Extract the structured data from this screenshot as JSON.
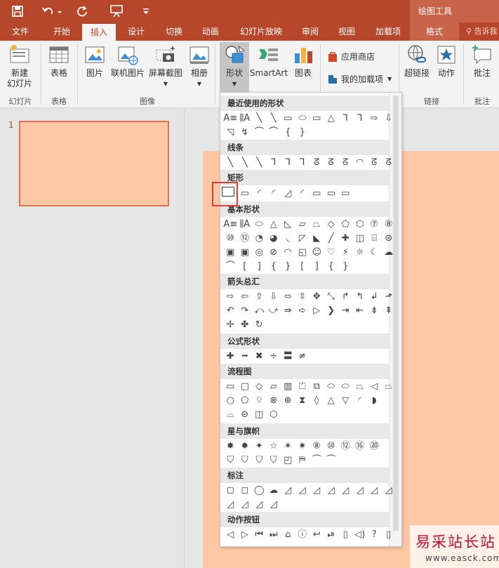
{
  "quick_access": {
    "save_icon": "save-icon",
    "undo_icon": "undo-icon",
    "redo_icon": "repeat-icon",
    "present_icon": "present-from-start-icon",
    "customize_icon": "customize-qat-icon"
  },
  "contextual_group": "绘图工具",
  "tabs": [
    "文件",
    "开始",
    "插入",
    "设计",
    "切换",
    "动画",
    "幻灯片放映",
    "审阅",
    "视图",
    "加载项",
    "格式"
  ],
  "active_tab": "插入",
  "tell_me": "告诉我",
  "ribbon": {
    "new_slide": [
      "新建",
      "幻灯片"
    ],
    "table": "表格",
    "picture": "图片",
    "online_picture": "联机图片",
    "screenshot": "屏幕截图",
    "album": "相册",
    "shapes": "形状",
    "smartart": "SmartArt",
    "chart": "图表",
    "store": "应用商店",
    "my_addins": "我的加载项",
    "hyperlink": "超链接",
    "action": "动作",
    "comment": "批注",
    "groups": {
      "slides": "幻灯片",
      "tables": "表格",
      "images": "图像",
      "links": "链接",
      "comments": "批注"
    }
  },
  "slide_panel": {
    "slide_number": "1"
  },
  "gallery": {
    "categories": [
      "最近使用的形状",
      "线条",
      "矩形",
      "基本形状",
      "箭头总汇",
      "公式形状",
      "流程图",
      "星与旗帜",
      "标注",
      "动作按钮"
    ],
    "rows": {
      "recent": [
        [
          "A≡",
          "⫼A",
          "╲",
          "╲",
          "▭",
          "⬭",
          "▭",
          "△",
          "⅂",
          "⅂",
          "⇨",
          "⇩"
        ],
        [
          "◹",
          "↯",
          "⌒",
          "⌒",
          "{",
          "}"
        ]
      ],
      "lines": [
        [
          "╲",
          "╲",
          "╲",
          "⅂",
          "⅂",
          "⅂",
          "ᘔ",
          "ᘔ",
          "ᘔ",
          "◠",
          "ᘔ",
          "ᘔ"
        ]
      ],
      "rectangles": [
        [
          "▭",
          "▭",
          "◜",
          "◜",
          "◿",
          "◜",
          "▭",
          "▭",
          "▭"
        ]
      ],
      "basic": [
        [
          "A≡",
          "⫼A",
          "⬭",
          "△",
          "◺",
          "▱",
          "⏢",
          "◇",
          "⬠",
          "⬡",
          "⑦",
          "⑧"
        ],
        [
          "⑩",
          "⑫",
          "◔",
          "◕",
          "◟",
          "◸",
          "◣",
          "╱",
          "✚",
          "◫",
          "⌸",
          "⊜"
        ],
        [
          "▣",
          "▣",
          "◎",
          "⊘",
          "◠",
          "◱",
          "☺",
          "♡",
          "⚡",
          "☼",
          "☾",
          "☁"
        ],
        [
          "⌒",
          "[",
          "]",
          "{",
          "}",
          "[",
          "]",
          "{",
          "}"
        ]
      ],
      "arrows": [
        [
          "⇨",
          "⇦",
          "⇧",
          "⇩",
          "⬄",
          "⇳",
          "✥",
          "⤡",
          "↱",
          "↰",
          "↲",
          "⬏"
        ],
        [
          "↶",
          "↷",
          "⤺",
          "⤻",
          "⇛",
          "➪",
          "▷",
          "❯",
          "⇥",
          "⇤",
          "⇟",
          "⇞"
        ],
        [
          "✢",
          "✤",
          "↻"
        ]
      ],
      "equation": [
        [
          "✚",
          "━",
          "✖",
          "÷",
          "〓",
          "≠"
        ]
      ],
      "flowchart": [
        [
          "▭",
          "▢",
          "◇",
          "▱",
          "▥",
          "⏍",
          "⧉",
          "⬭",
          "⬭",
          "⏢",
          "◁",
          "⏢"
        ],
        [
          "○",
          "⬠",
          "⌔",
          "⊗",
          "⊕",
          "⧗",
          "◊",
          "△",
          "▽",
          "◜",
          "◗"
        ],
        [
          "⌓",
          "⊖",
          "◫",
          "⬡"
        ]
      ],
      "stars": [
        [
          "✸",
          "✹",
          "✦",
          "☆",
          "✶",
          "✷",
          "⑧",
          "⑩",
          "⑫",
          "⑯",
          "⑳"
        ],
        [
          "⛉",
          "⛉",
          "⛉",
          "⛉",
          "◰",
          "⛿",
          "⏜",
          "⏜"
        ]
      ],
      "callouts": [
        [
          "◻",
          "◻",
          "◯",
          "☁",
          "◿",
          "◿",
          "◿",
          "◿",
          "◿",
          "◿",
          "◿",
          "◿"
        ],
        [
          "◿",
          "◿",
          "◿",
          "◿"
        ]
      ],
      "action_buttons": [
        [
          "◁",
          "▷",
          "⏮",
          "⏭",
          "⌂",
          "ⓘ",
          "↩",
          "⏯",
          "▯",
          "◁)",
          "?",
          "▯"
        ]
      ]
    }
  },
  "watermark": {
    "title": "易采站长站",
    "url": "www.easck.com"
  }
}
